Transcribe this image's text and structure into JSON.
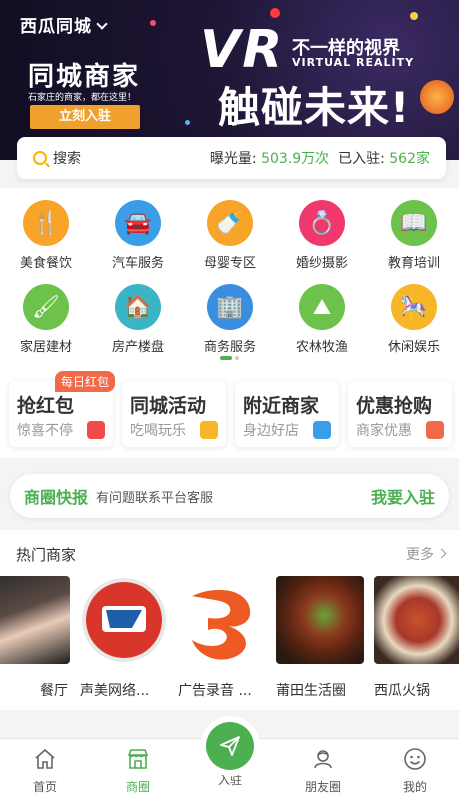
{
  "header": {
    "city": "西瓜同城"
  },
  "banner": {
    "left_title": "同城商家",
    "left_subtitle": "石家庄的商家，都在这里！",
    "left_button": "立刻入驻",
    "vr_big": "VR",
    "vr_line1": "不一样的视界",
    "vr_line2": "VIRTUAL REALITY",
    "vr_line3": "触碰未来!"
  },
  "search": {
    "placeholder": "搜索",
    "exposure_label": "曝光量:",
    "exposure_value": "503.9万次",
    "joined_label": "已入驻:",
    "joined_value": "562家"
  },
  "categories": [
    {
      "label": "美食餐饮",
      "color": "#f7a428",
      "glyph": "🍴"
    },
    {
      "label": "汽车服务",
      "color": "#3a9de8",
      "glyph": "🚘"
    },
    {
      "label": "母婴专区",
      "color": "#f7a428",
      "glyph": "🍼"
    },
    {
      "label": "婚纱摄影",
      "color": "#f0386c",
      "glyph": "💍"
    },
    {
      "label": "教育培训",
      "color": "#6cc24a",
      "glyph": "📖"
    },
    {
      "label": "家居建材",
      "color": "#6cc24a",
      "glyph": "🖌"
    },
    {
      "label": "房产楼盘",
      "color": "#3ab5c6",
      "glyph": "🏠"
    },
    {
      "label": "商务服务",
      "color": "#3a8ee0",
      "glyph": "🏢"
    },
    {
      "label": "农林牧渔",
      "color": "#6cc24a",
      "glyph": "⛰"
    },
    {
      "label": "休闲娱乐",
      "color": "#f7b528",
      "glyph": "🎠"
    }
  ],
  "features": [
    {
      "title": "抢红包",
      "sub": "惊喜不停",
      "icon_color": "#f04a4a"
    },
    {
      "title": "同城活动",
      "sub": "吃喝玩乐",
      "icon_color": "#f7b528"
    },
    {
      "title": "附近商家",
      "sub": "身边好店",
      "icon_color": "#3a9de8"
    },
    {
      "title": "优惠抢购",
      "sub": "商家优惠",
      "icon_color": "#f06a4a"
    }
  ],
  "feature_tag": "每日红包",
  "news": {
    "title": "商圈快报",
    "message": "有问题联系平台客服",
    "action": "我要入驻"
  },
  "hot": {
    "title": "热门商家",
    "more": "更多",
    "merchants": [
      {
        "name": "餐厅"
      },
      {
        "name": "声美网络..."
      },
      {
        "name": "广告录音 ..."
      },
      {
        "name": "莆田生活圈"
      },
      {
        "name": "西瓜火锅"
      }
    ]
  },
  "tabbar": [
    {
      "label": "首页",
      "icon": "home-icon"
    },
    {
      "label": "商圈",
      "icon": "store-icon"
    },
    {
      "label": "入驻",
      "icon": "send-icon"
    },
    {
      "label": "朋友圈",
      "icon": "friends-icon"
    },
    {
      "label": "我的",
      "icon": "smile-icon"
    }
  ],
  "colors": {
    "brand_green": "#4caf50",
    "accent_orange": "#f0a02c"
  }
}
